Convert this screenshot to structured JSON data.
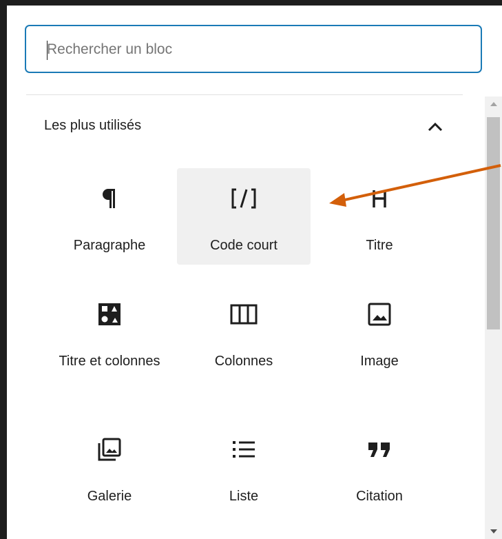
{
  "search": {
    "placeholder": "Rechercher un bloc",
    "value": ""
  },
  "section": {
    "title": "Les plus utilisés"
  },
  "blocks": [
    {
      "label": "Paragraphe",
      "icon": "paragraph-icon"
    },
    {
      "label": "Code court",
      "icon": "shortcode-icon"
    },
    {
      "label": "Titre",
      "icon": "heading-icon"
    },
    {
      "label": "Titre et colonnes",
      "icon": "media-text-icon"
    },
    {
      "label": "Colonnes",
      "icon": "columns-icon"
    },
    {
      "label": "Image",
      "icon": "image-icon"
    },
    {
      "label": "Galerie",
      "icon": "gallery-icon"
    },
    {
      "label": "Liste",
      "icon": "list-icon"
    },
    {
      "label": "Citation",
      "icon": "quote-icon"
    }
  ],
  "colors": {
    "accent": "#1a7ab6",
    "annotation_arrow": "#d35f0a",
    "text": "#1e1e1e",
    "hover": "#f0f0f0"
  }
}
